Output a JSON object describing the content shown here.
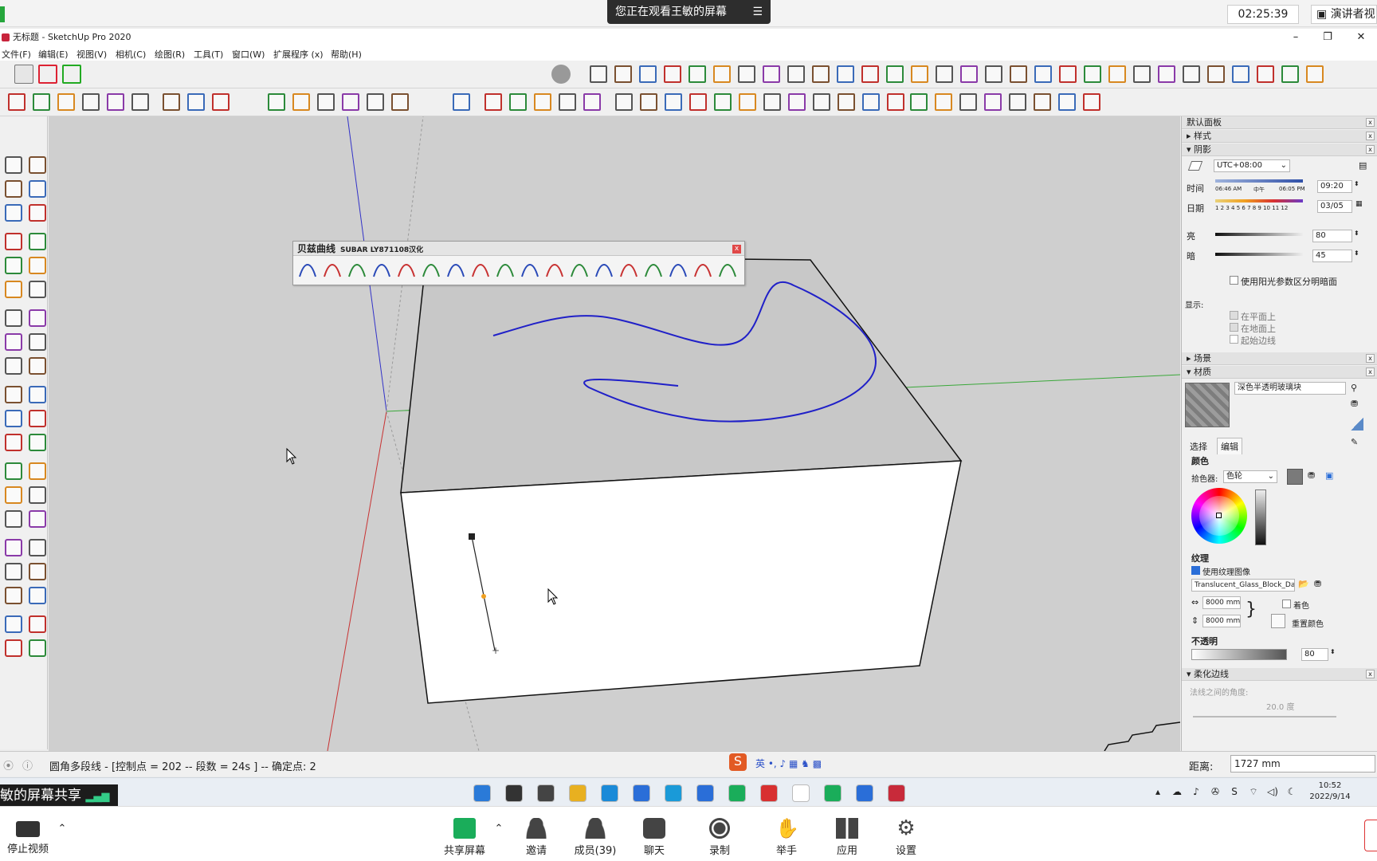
{
  "share": {
    "notice": "您正在观看王敏的屏幕",
    "clock": "02:25:39",
    "presenter_view": "演讲者视",
    "share_tag": "敏的屏幕共享"
  },
  "window": {
    "title": "无标题 - SketchUp Pro 2020",
    "minimize": "–",
    "restore": "❐",
    "close": "✕"
  },
  "menu": [
    "文件(F)",
    "编辑(E)",
    "视图(V)",
    "相机(C)",
    "绘图(R)",
    "工具(T)",
    "窗口(W)",
    "扩展程序 (x)",
    "帮助(H)"
  ],
  "bezier_toolbar": {
    "title": "贝兹曲线",
    "subtitle": "SUBAR LY871108汉化",
    "close": "x"
  },
  "status": {
    "text": "圆角多段线 - [控制点 = 202 -- 段数 = 24s ] -- 确定点: 2",
    "distance_label": "距离:",
    "distance_value": "1727 mm"
  },
  "right_panel": {
    "title": "默认面板",
    "sections": {
      "style": "样式",
      "shadow": "阴影",
      "scenes": "场景",
      "materials": "材质",
      "soften": "柔化边线"
    },
    "shadow": {
      "timezone": "UTC+08:00",
      "time_label": "时间",
      "time_start": "06:46 AM",
      "time_mid": "中午",
      "time_end": "06:05 PM",
      "time_value": "09:20",
      "date_label": "日期",
      "months": "1 2 3 4 5 6 7 8 9 10 11 12",
      "date_value": "03/05",
      "light_label": "亮",
      "light_value": "80",
      "dark_label": "暗",
      "dark_value": "45",
      "use_sun": "使用阳光参数区分明暗面",
      "display_label": "显示:",
      "on_faces": "在平面上",
      "on_ground": "在地面上",
      "from_edges": "起始边线"
    },
    "materials": {
      "name": "深色半透明玻璃块",
      "tab_select": "选择",
      "tab_edit": "编辑",
      "color_label": "颜色",
      "picker_label": "拾色器:",
      "picker_value": "色轮",
      "texture_label": "纹理",
      "use_texture": "使用纹理图像",
      "texture_file": "Translucent_Glass_Block_Dark.",
      "width": "8000 mm",
      "height": "8000 mm",
      "colorize": "着色",
      "reset_color": "重置颜色",
      "opacity_label": "不透明",
      "opacity_value": "80"
    },
    "soften": {
      "angle_label": "法线之间的角度:",
      "angle_value": "20.0  度"
    }
  },
  "taskbar": {
    "time": "10:52",
    "date": "2022/9/14"
  },
  "meeting": {
    "stop_video": "停止视频",
    "share_screen": "共享屏幕",
    "invite": "邀请",
    "members": "成员(39)",
    "chat": "聊天",
    "record": "录制",
    "raise_hand": "举手",
    "apps": "应用",
    "settings": "设置"
  },
  "colors": {
    "curve": "#2020c8",
    "axis_red": "#c83232",
    "axis_green": "#3aa83a",
    "axis_blue": "#3232c8",
    "meeting_green": "#1aad5a"
  }
}
